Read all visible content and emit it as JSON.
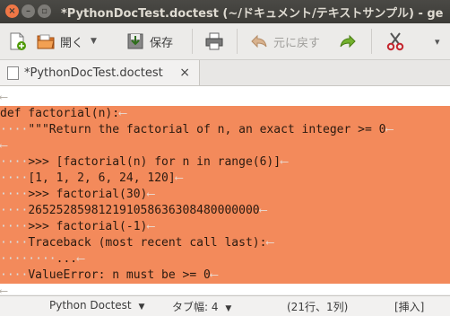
{
  "window": {
    "title": "*PythonDocTest.doctest (~/ドキュメント/テキストサンプル) - ge"
  },
  "toolbar": {
    "open_label": "開く",
    "save_label": "保存",
    "undo_label": "元に戻す"
  },
  "tab": {
    "title": "*PythonDocTest.doctest",
    "close": "×"
  },
  "editor": {
    "newline_glyph": "⟵",
    "lines": [
      {
        "lead": "",
        "text": "",
        "selected": false
      },
      {
        "lead": "",
        "text": "def factorial(n):",
        "selected": true
      },
      {
        "lead": "····",
        "text": "\"\"\"Return the factorial of n, an exact integer >= 0",
        "selected": true
      },
      {
        "lead": "",
        "text": "",
        "selected": true
      },
      {
        "lead": "····",
        "text": ">>> [factorial(n) for n in range(6)]",
        "selected": true
      },
      {
        "lead": "····",
        "text": "[1, 1, 2, 6, 24, 120]",
        "selected": true
      },
      {
        "lead": "····",
        "text": ">>> factorial(30)",
        "selected": true
      },
      {
        "lead": "····",
        "text": "265252859812191058636308480000000",
        "selected": true
      },
      {
        "lead": "····",
        "text": ">>> factorial(-1)",
        "selected": true
      },
      {
        "lead": "····",
        "text": "Traceback (most recent call last):",
        "selected": true
      },
      {
        "lead": "········",
        "text": "...",
        "selected": true
      },
      {
        "lead": "····",
        "text": "ValueError: n must be >= 0",
        "selected": true
      },
      {
        "lead": "",
        "text": "",
        "selected": false
      }
    ]
  },
  "statusbar": {
    "language": "Python Doctest",
    "tab_width": "タブ幅: 4",
    "position": "(21行、1列)",
    "mode": "[挿入]"
  },
  "colors": {
    "selection": "#f38a5b",
    "titlebar": "#3c3b37",
    "close_button": "#f07746"
  }
}
